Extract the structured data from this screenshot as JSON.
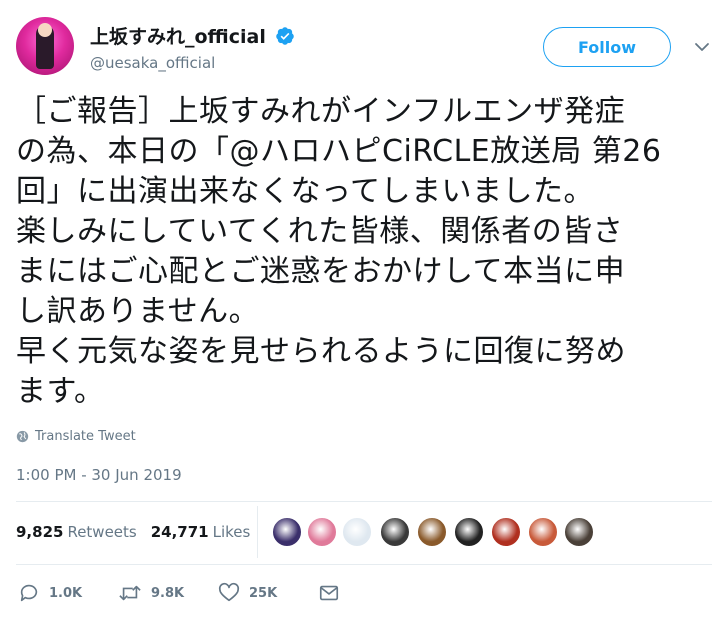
{
  "user": {
    "display_name": "上坂すみれ_official",
    "handle": "@uesaka_official",
    "verified": true,
    "avatar_icon": "profile-avatar"
  },
  "follow_label": "Follow",
  "tweet": {
    "lines": [
      "［ご報告］上坂すみれがインフルエンザ発症",
      "の為、本日の「@ハロハピCiRCLE放送局 第26",
      "回」に出演出来なくなってしまいました。",
      "楽しみにしていてくれた皆様、関係者の皆さ",
      "まにはご心配とご迷惑をおかけして本当に申",
      "し訳ありません。",
      "早く元気な姿を見せられるように回復に努め",
      "ます。"
    ]
  },
  "translate_label": "Translate Tweet",
  "timestamp": "1:00 PM - 30 Jun 2019",
  "stats": {
    "retweets_count": "9,825",
    "retweets_label": "Retweets",
    "likes_count": "24,771",
    "likes_label": "Likes"
  },
  "liker_colors": [
    "#3b2f6b",
    "#e07a9a",
    "#dfe8f0",
    "#3a3a3a",
    "#8a5a2b",
    "#222222",
    "#b03020",
    "#c85a3a",
    "#4a4038"
  ],
  "actions": {
    "reply_count": "1.0K",
    "retweet_count": "9.8K",
    "like_count": "25K"
  },
  "colors": {
    "accent": "#1da1f2",
    "secondary_text": "#657786",
    "divider": "#e6ecf0"
  }
}
